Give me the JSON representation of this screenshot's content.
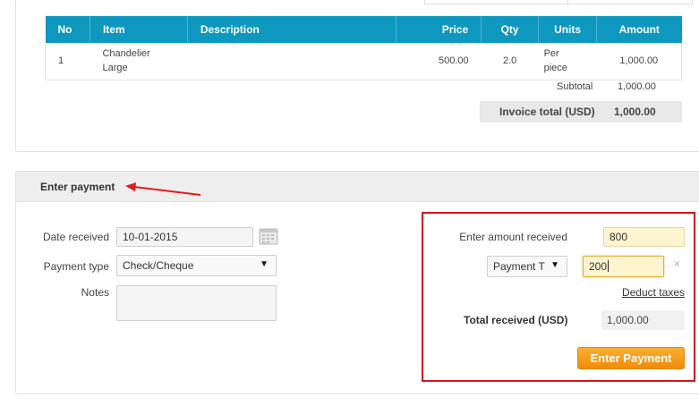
{
  "items_table": {
    "headers": {
      "no": "No",
      "item": "Item",
      "description": "Description",
      "price": "Price",
      "qty": "Qty",
      "units": "Units",
      "amount": "Amount"
    },
    "rows": [
      {
        "no": "1",
        "item_line1": "Chandelier",
        "item_line2": "Large",
        "description": "",
        "price": "500.00",
        "qty": "2.0",
        "units_line1": "Per",
        "units_line2": "piece",
        "amount": "1,000.00"
      }
    ]
  },
  "summary": {
    "subtotal_label": "Subtotal",
    "subtotal_value": "1,000.00",
    "invoice_total_label": "Invoice total (USD)",
    "invoice_total_value": "1,000.00"
  },
  "payment": {
    "title": "Enter payment",
    "date_label": "Date received",
    "date_value": "10-01-2015",
    "payment_type_label": "Payment type",
    "payment_type_value": "Check/Cheque",
    "notes_label": "Notes",
    "notes_value": "",
    "amount_received_label": "Enter amount received",
    "amount_received_value": "800",
    "payment_method_value": "Payment T",
    "payment_method_amount": "200",
    "remove_symbol": "×",
    "deduct_taxes_label": "Deduct taxes",
    "total_received_label": "Total received (USD)",
    "total_received_value": "1,000.00",
    "enter_button_label": "Enter Payment"
  },
  "colors": {
    "table_header": "#0e98bf",
    "highlight_border": "#d9131b",
    "button_orange": "#f49a1a",
    "input_yellow": "#fdf5d0"
  },
  "icons": {
    "calendar": "calendar-icon",
    "dropdown": "chevron-down-icon",
    "remove": "close-icon",
    "annotation": "arrow-icon"
  }
}
